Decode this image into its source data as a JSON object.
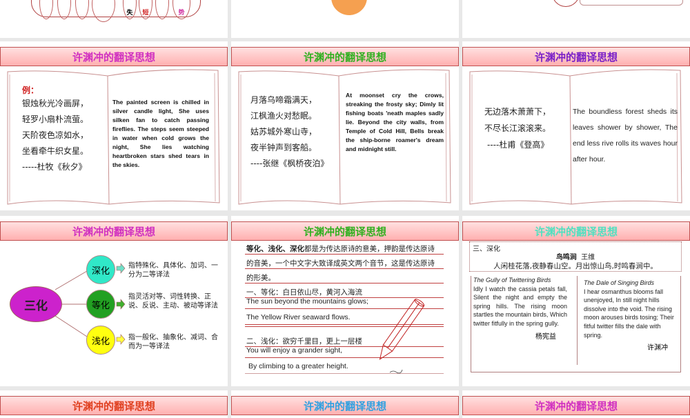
{
  "title_text": "许渊冲的翻译思想",
  "colors": {
    "row2": [
      "#d030c0",
      "#30b020",
      "#7a20c8"
    ],
    "row3": [
      "#d030c0",
      "#30b020",
      "#50e0c0"
    ],
    "row4": [
      "#e04020",
      "#30a0e0",
      "#d030c0"
    ]
  },
  "top_row": {
    "slide1_ovals": [
      "失",
      "短",
      "势"
    ]
  },
  "slide_qiuxi": {
    "label": "例：",
    "cn_lines": [
      "银烛秋光冷画屏，",
      "轻罗小扇朴流萤。",
      "天阶夜色凉如水，",
      "坐看牵牛织女星。",
      "-----杜牧《秋夕》"
    ],
    "en_text": "The painted screen is chilled in silver candle light, She uses silken fan to catch passing fireflies. The steps seem steeped in water when cold grows the night, She lies watching heartbroken stars shed tears in the skies."
  },
  "slide_fengqiao": {
    "cn_lines": [
      "月落乌啼霜满天，",
      "江枫渔火对愁眠。",
      "姑苏城外寒山寺，",
      "夜半钟声到客船。",
      "----张继《枫桥夜泊》"
    ],
    "en_text": "At moonset cry the crows, streaking the frosty sky; Dimly lit fishing boats 'neath maples sadly lie. Beyond the city walls, from Temple of Cold Hill, Bells break the ship-borne roamer's dream and midnight still."
  },
  "slide_denggao": {
    "cn_lines": [
      "无边落木萧萧下，",
      "不尽长江滚滚来。",
      "----杜甫《登高》"
    ],
    "en_text": "The boundless forest sheds its leaves shower by shower, The end less rive rolls its waves hour after hour."
  },
  "slide_sanhua": {
    "center": "三化",
    "items": [
      {
        "label": "深化",
        "desc": "指特殊化、具体化、加词、一分为二等译法"
      },
      {
        "label": "等化",
        "desc": "指灵活对等、词性转换、正说、反说、主动、被动等译法"
      },
      {
        "label": "浅化",
        "desc": "指一般化、抽象化、减词、合而为一等译法"
      }
    ]
  },
  "slide_lines": {
    "intro_bold": "等化、浅化、深化",
    "intro_rest1": "都是为传达原诗的意美，押韵是传达原诗",
    "intro_line2": "的音美，一个中文字大致译成英文两个音节，这是传达原诗",
    "intro_line3": "的形美。",
    "s1_head": "一、等化：白日依山尽，黄河入海流",
    "s1_en1": "The sun beyond the mountains glows;",
    "s1_en2": "The Yellow River seaward flows.",
    "s2_head": "二、浅化：欲穷千里目，更上一层楼",
    "s2_en1": "You will enjoy a grander sight,",
    "s2_en2": "By climbing to a greater height."
  },
  "slide_shenhua": {
    "head": "三、深化",
    "poem_title": "鸟鸣涧",
    "poem_author": "王维",
    "poem_text": "人闲桂花落,夜静春山空。月出惊山鸟,时鸣春涧中。",
    "left_title": "The Gully of Twittering Birds",
    "left_text": "Idly I watch the cassia petals fall, Silent the night and empty the spring hills. The rising moon startles the mountain birds, Which twitter fitfully in the spring gully.",
    "left_translator": "杨宪益",
    "right_title": "The Dale of Singing Birds",
    "right_text": "I hear osmanthus blooms fall unenjoyed, In still night hills dissolve into the void. The rising moon arouses birds tosing; Their fitful twitter fills the dale with spring.",
    "right_translator": "许渊冲"
  }
}
